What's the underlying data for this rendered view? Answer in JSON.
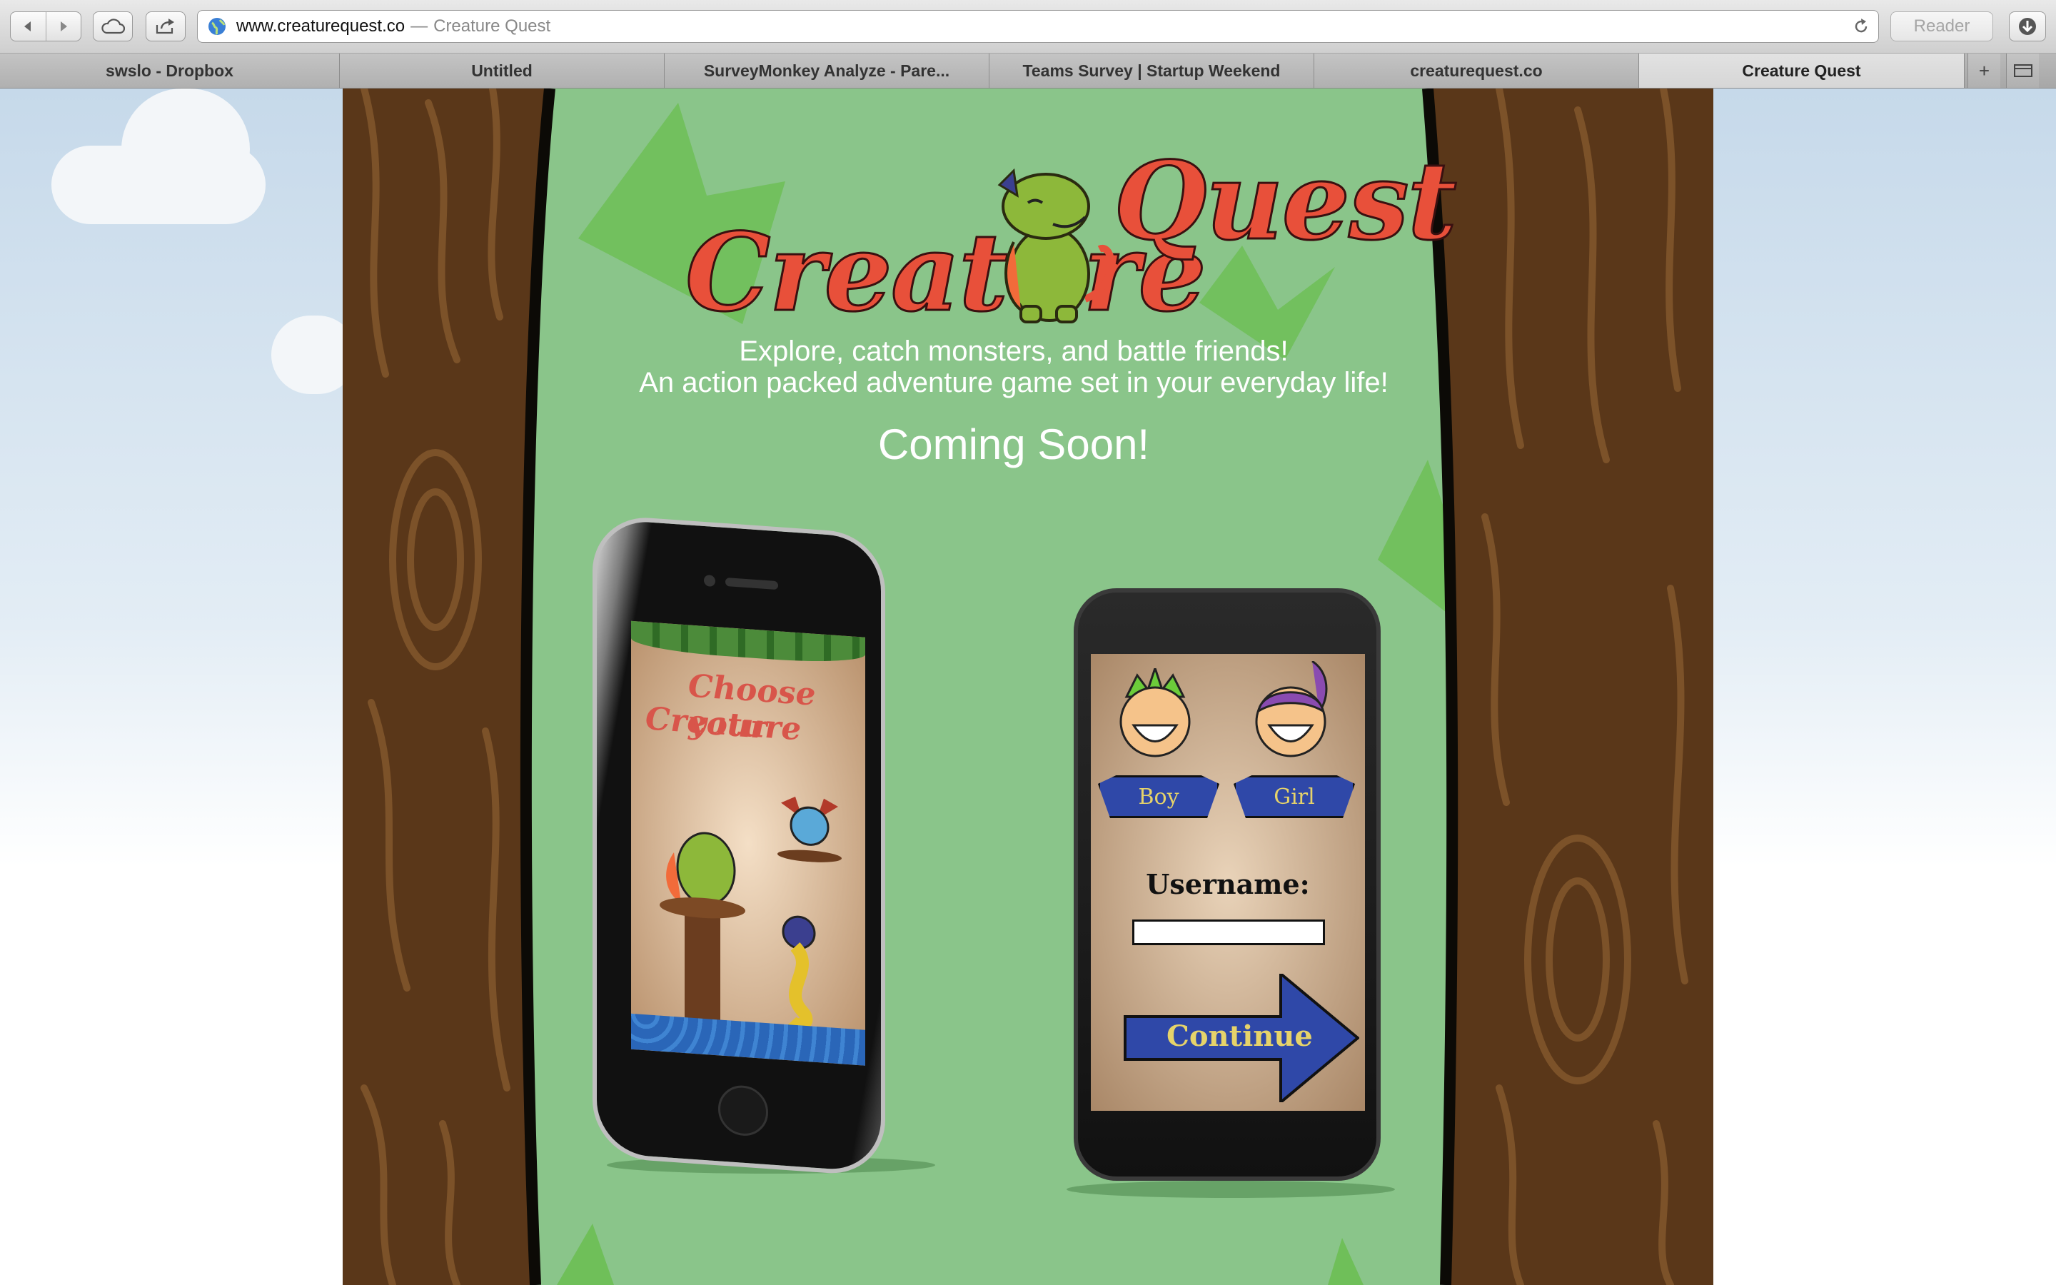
{
  "browser": {
    "url": "www.creaturequest.co",
    "title_separator": "—",
    "page_title": "Creature Quest",
    "reader_label": "Reader",
    "tabs": [
      {
        "label": "swslo - Dropbox",
        "active": false
      },
      {
        "label": "Untitled",
        "active": false
      },
      {
        "label": "SurveyMonkey Analyze - Pare...",
        "active": false
      },
      {
        "label": "Teams Survey | Startup Weekend",
        "active": false
      },
      {
        "label": "creaturequest.co",
        "active": false
      },
      {
        "label": "Creature Quest",
        "active": true
      }
    ],
    "icons": [
      "back-icon",
      "forward-icon",
      "icloud-icon",
      "share-icon",
      "globe-icon",
      "reload-icon",
      "download-icon",
      "new-tab-icon",
      "tab-list-icon"
    ]
  },
  "site": {
    "logo": {
      "word1": "Creature",
      "word2": "Quest"
    },
    "tagline_1": "Explore, catch monsters, and battle friends!",
    "tagline_2": "An action packed adventure game set in your everyday life!",
    "coming_soon": "Coming Soon!",
    "iphone_screen": {
      "heading_1": "Choose your",
      "heading_2": "Creature"
    },
    "android_screen": {
      "option_boy": "Boy",
      "option_girl": "Girl",
      "username_label": "Username:",
      "username_value": "",
      "continue_label": "Continue"
    },
    "colors": {
      "grass": "#8ac58a",
      "bark": "#5a3719",
      "logo_red": "#e8503a",
      "banner_blue": "#2f48a8",
      "sky_top": "#c6d9ea"
    }
  }
}
